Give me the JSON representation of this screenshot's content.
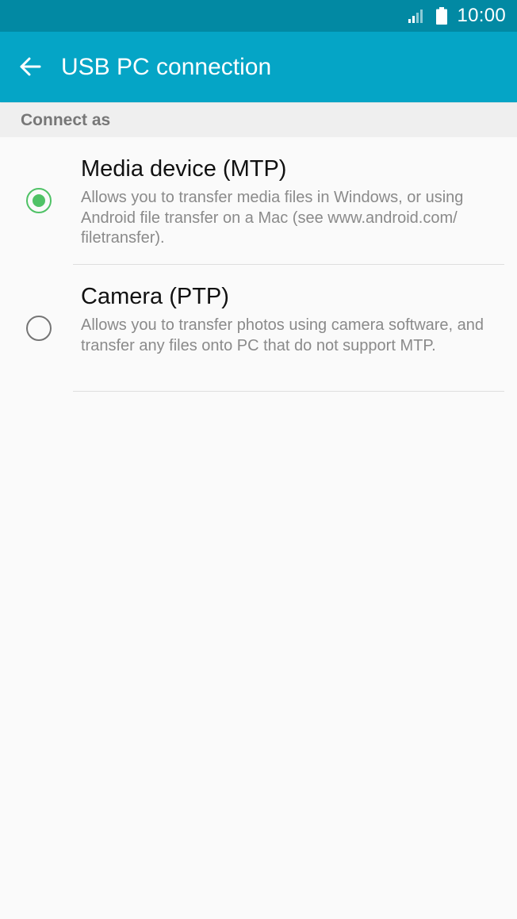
{
  "status_bar": {
    "time": "10:00",
    "signal_icon": "signal-icon",
    "battery_icon": "battery-icon",
    "background_color": "#0289a3"
  },
  "app_bar": {
    "title": "USB PC connection",
    "back_icon": "back-arrow-icon",
    "background_color": "#05a5c6"
  },
  "section": {
    "header": "Connect as"
  },
  "options": [
    {
      "title": "Media device (MTP)",
      "description": "Allows you to transfer media files in Windows, or using Android file transfer on a Mac (see www.android.com/ filetransfer).",
      "selected": true
    },
    {
      "title": "Camera (PTP)",
      "description": "Allows you to transfer photos using camera software, and transfer any files onto PC that do not support MTP.",
      "selected": false
    }
  ],
  "colors": {
    "accent": "#4fc266",
    "section_background": "#efefef",
    "page_background": "#fafafa"
  }
}
